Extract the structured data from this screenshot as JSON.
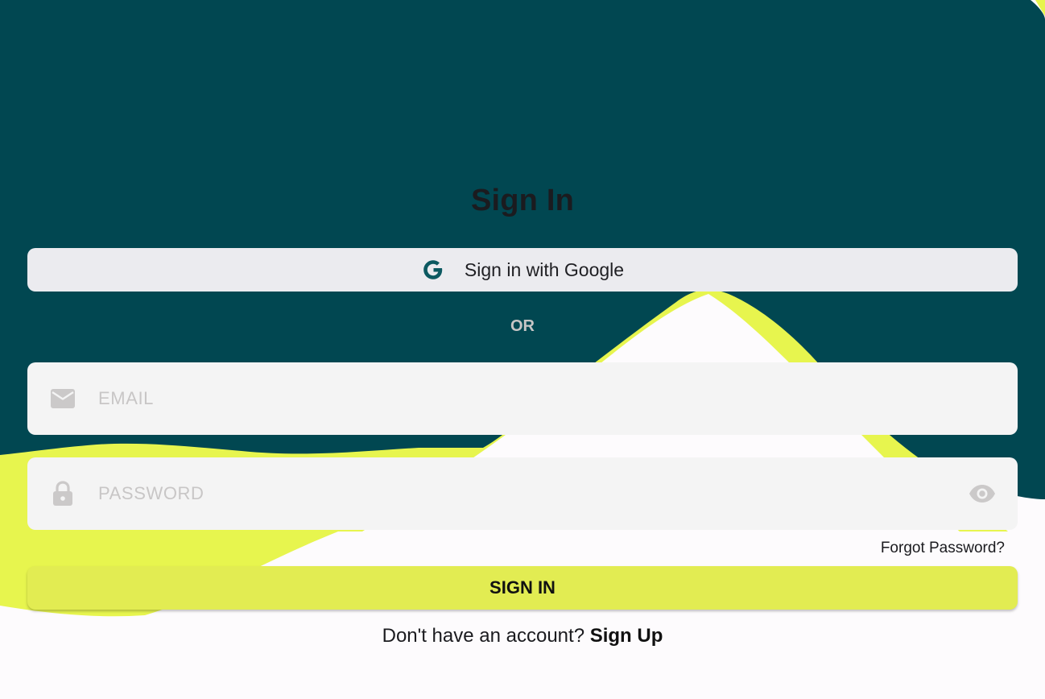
{
  "colors": {
    "background_dark": "#014751",
    "background_accent": "#e7f54e",
    "background_light": "#fdfbfd",
    "primary_button": "#e2ec52",
    "google_button": "#ebebef",
    "field_background": "#f4f4f4",
    "google_icon": "#0c5961"
  },
  "page": {
    "title": "Sign In"
  },
  "google_button": {
    "icon": "google-g-icon",
    "label": "Sign in with Google"
  },
  "divider": {
    "label": "OR"
  },
  "email_field": {
    "icon": "mail-icon",
    "placeholder": "EMAIL",
    "value": ""
  },
  "password_field": {
    "icon": "lock-icon",
    "placeholder": "PASSWORD",
    "value": "",
    "toggle_icon": "eye-icon"
  },
  "forgot_password": {
    "label": "Forgot Password?"
  },
  "sign_in_button": {
    "label": "SIGN IN"
  },
  "sign_up_prompt": {
    "text": "Don't have an account?",
    "link_label": "Sign Up"
  }
}
